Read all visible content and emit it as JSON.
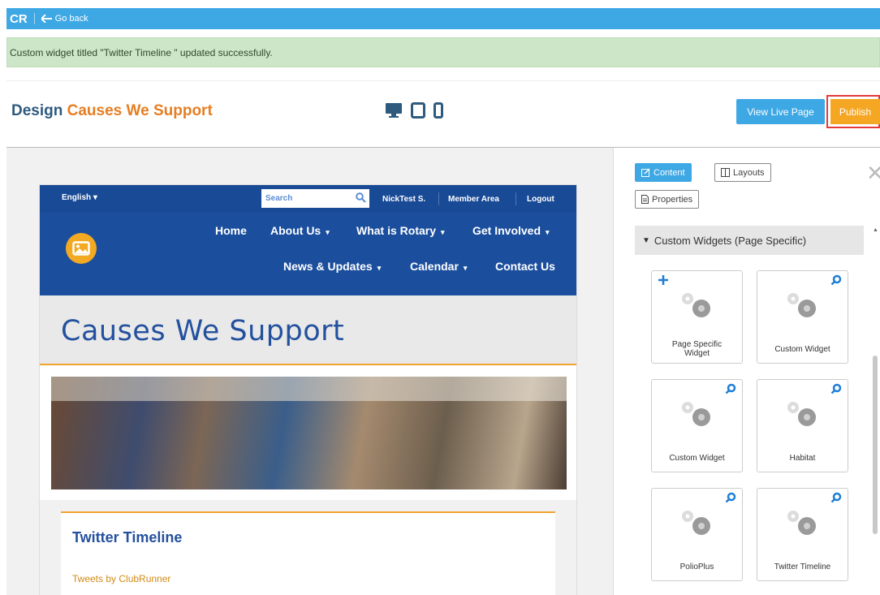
{
  "topbar": {
    "logo": "CR",
    "back_label": "Go back",
    "accent": "#3ea8e5"
  },
  "alert": {
    "message": "Custom widget titled \"Twitter Timeline \" updated successfully."
  },
  "header": {
    "design_label": "Design",
    "page_name": "Causes We Support",
    "devices": [
      "desktop-icon",
      "tablet-icon",
      "mobile-icon"
    ],
    "view_live_label": "View Live Page",
    "publish_label": "Publish"
  },
  "site": {
    "language": "English",
    "search_placeholder": "Search",
    "user": "NickTest S.",
    "member_area": "Member Area",
    "logout": "Logout",
    "nav": [
      {
        "label": "Home",
        "dropdown": false
      },
      {
        "label": "About Us",
        "dropdown": true
      },
      {
        "label": "What is Rotary",
        "dropdown": true
      },
      {
        "label": "Get Involved",
        "dropdown": true
      },
      {
        "label": "News & Updates",
        "dropdown": true
      },
      {
        "label": "Calendar",
        "dropdown": true
      },
      {
        "label": "Contact Us",
        "dropdown": false
      }
    ],
    "page_title": "Causes We Support",
    "twitter_title": "Twitter Timeline",
    "tweets_link": "Tweets by ClubRunner"
  },
  "panel": {
    "tabs": {
      "content": "Content",
      "layouts": "Layouts",
      "properties": "Properties"
    },
    "section_title": "Custom Widgets (Page Specific)",
    "widgets": [
      {
        "label_line1": "Page Specific",
        "label_line2": "Widget",
        "corner_icon": "plus-icon"
      },
      {
        "label_line1": "Custom Widget",
        "label_line2": "",
        "corner_icon": "search-icon"
      },
      {
        "label_line1": "Custom Widget",
        "label_line2": "",
        "corner_icon": "search-icon"
      },
      {
        "label_line1": "Habitat",
        "label_line2": "",
        "corner_icon": "search-icon"
      },
      {
        "label_line1": "PolioPlus",
        "label_line2": "",
        "corner_icon": "search-icon"
      },
      {
        "label_line1": "Twitter Timeline",
        "label_line2": "",
        "corner_icon": "search-icon"
      }
    ]
  },
  "colors": {
    "brand_blue": "#194a96",
    "orange": "#f5a623",
    "title_blue": "#2e5a7e",
    "success_bg": "#cce6c7"
  }
}
